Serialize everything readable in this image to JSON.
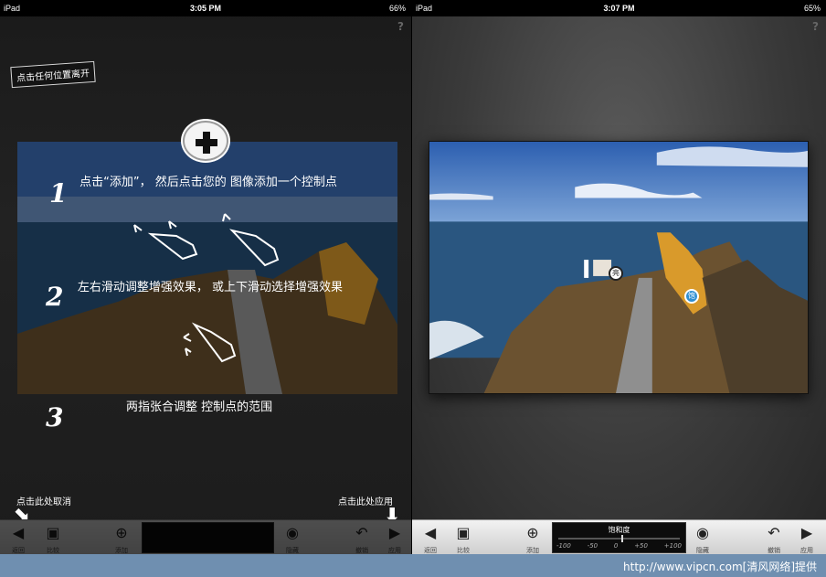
{
  "left": {
    "status": {
      "device": "iPad",
      "time": "3:05 PM",
      "battery": "66%"
    },
    "help": "?",
    "leave_note": "点击任何位置离开",
    "steps": [
      {
        "num": "1",
        "text": "点击“添加”， 然后点击您的 图像添加一个控制点"
      },
      {
        "num": "2",
        "text": "左右滑动调整增强效果， 或上下滑动选择增强效果"
      },
      {
        "num": "3",
        "text": "两指张合调整 控制点的范围"
      }
    ],
    "cancel_note": "点击此处取消",
    "apply_note": "点击此处应用",
    "toolbar": {
      "back": "返回",
      "compare": "比较",
      "add": "添加",
      "hide": "隐藏",
      "undo": "撤销",
      "apply": "应用"
    }
  },
  "right": {
    "status": {
      "device": "iPad",
      "time": "3:07 PM",
      "battery": "65%"
    },
    "help": "?",
    "markers": [
      {
        "label": "亮",
        "color": "#ffffff"
      },
      {
        "label": "饱",
        "color": "#2f8fd1"
      }
    ],
    "toolbar": {
      "back": "返回",
      "compare": "比较",
      "add": "添加",
      "hide": "隐藏",
      "undo": "撤销",
      "apply": "应用",
      "slider_name": "饱和度",
      "slider_ticks": [
        "-100",
        "-50",
        "0",
        "+50",
        "+100"
      ],
      "slider_value_percent": 52
    }
  },
  "footer": {
    "credit": "http://www.vipcn.com[清风网络]提供"
  },
  "colors": {
    "sky": "#3d6fb8",
    "sea": "#27517a",
    "rock": "#8a6a3c",
    "sunrock": "#d99a2b"
  },
  "icons": [
    "back-arrow-icon",
    "photo-icon",
    "plus-circle-icon",
    "eye-icon",
    "undo-icon",
    "forward-arrow-icon"
  ]
}
